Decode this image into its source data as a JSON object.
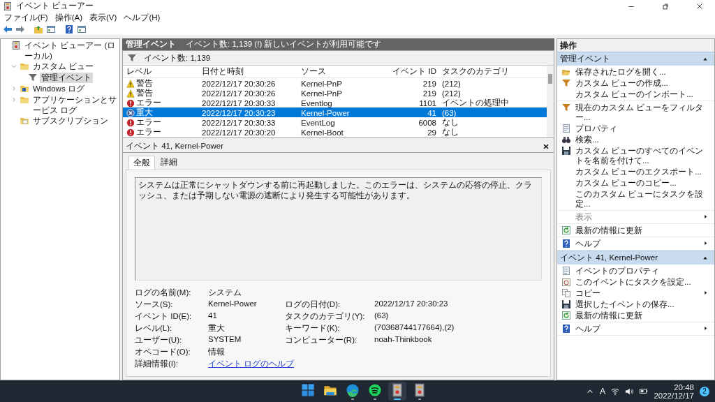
{
  "window": {
    "title": "イベント ビューアー"
  },
  "menu": [
    "ファイル(F)",
    "操作(A)",
    "表示(V)",
    "ヘルプ(H)"
  ],
  "tree": [
    {
      "label": "イベント ビューアー (ローカル)",
      "kind": "viewer",
      "selected": false,
      "children": [
        {
          "label": "カスタム ビュー",
          "kind": "folder",
          "expanded": true,
          "selected": false,
          "children": [
            {
              "label": "管理イベント",
              "kind": "filter",
              "selected": true
            }
          ]
        },
        {
          "label": "Windows ログ",
          "kind": "log",
          "expanded": false,
          "selected": false
        },
        {
          "label": "アプリケーションとサービス ログ",
          "kind": "folder",
          "expanded": false,
          "selected": false
        },
        {
          "label": "サブスクリプション",
          "kind": "subscription",
          "selected": false
        }
      ]
    }
  ],
  "center": {
    "title": "管理イベント",
    "notice": "イベント数: 1,139 (!) 新しいイベントが利用可能です",
    "filter_label": "イベント数: 1,139"
  },
  "table": {
    "columns": [
      "レベル",
      "日付と時刻",
      "ソース",
      "イベント ID",
      "タスクのカテゴリ"
    ],
    "rows": [
      {
        "kind": "warning",
        "level": "警告",
        "date": "2022/12/17 20:30:26",
        "source": "Kernel-PnP",
        "event_id": "219",
        "category": "(212)",
        "selected": false
      },
      {
        "kind": "warning",
        "level": "警告",
        "date": "2022/12/17 20:30:26",
        "source": "Kernel-PnP",
        "event_id": "219",
        "category": "(212)",
        "selected": false
      },
      {
        "kind": "error",
        "level": "エラー",
        "date": "2022/12/17 20:30:33",
        "source": "Eventlog",
        "event_id": "1101",
        "category": "イベントの処理中",
        "selected": false
      },
      {
        "kind": "critical",
        "level": "重大",
        "date": "2022/12/17 20:30:23",
        "source": "Kernel-Power",
        "event_id": "41",
        "category": "(63)",
        "selected": true
      },
      {
        "kind": "error",
        "level": "エラー",
        "date": "2022/12/17 20:30:33",
        "source": "EventLog",
        "event_id": "6008",
        "category": "なし",
        "selected": false
      },
      {
        "kind": "error",
        "level": "エラー",
        "date": "2022/12/17 20:30:20",
        "source": "Kernel-Boot",
        "event_id": "29",
        "category": "なし",
        "selected": false
      }
    ]
  },
  "detail": {
    "title": "イベント 41, Kernel-Power",
    "tabs": [
      {
        "label": "全般",
        "selected": true
      },
      {
        "label": "詳細",
        "selected": false
      }
    ],
    "description": "システムは正常にシャットダウンする前に再起動しました。このエラーは、システムの応答の停止、クラッシュ、または予期しない電源の遮断により発生する可能性があります。",
    "rows": [
      {
        "left": {
          "label": "ログの名前(M):",
          "value": "システム"
        }
      },
      {
        "left": {
          "label": "ソース(S):",
          "value": "Kernel-Power"
        },
        "right": {
          "label": "ログの日付(D):",
          "value": "2022/12/17 20:30:23"
        }
      },
      {
        "left": {
          "label": "イベント ID(E):",
          "value": "41"
        },
        "right": {
          "label": "タスクのカテゴリ(Y):",
          "value": "(63)"
        }
      },
      {
        "left": {
          "label": "レベル(L):",
          "value": "重大"
        },
        "right": {
          "label": "キーワード(K):",
          "value": "(70368744177664),(2)"
        }
      },
      {
        "left": {
          "label": "ユーザー(U):",
          "value": "SYSTEM"
        },
        "right": {
          "label": "コンピューター(R):",
          "value": "noah-Thinkbook"
        }
      },
      {
        "left": {
          "label": "オペコード(O):",
          "value": "情報"
        }
      },
      {
        "left": {
          "label": "詳細情報(I):",
          "value": "イベント ログのヘルプ",
          "kind": "link"
        }
      }
    ]
  },
  "actions": {
    "title": "操作",
    "sections": [
      {
        "title": "管理イベント",
        "expanded": true,
        "groups": [
          [
            {
              "label": "保存されたログを開く...",
              "kind": "open",
              "submenu": false,
              "disabled": false
            },
            {
              "label": "カスタム ビューの作成...",
              "kind": "filter",
              "submenu": false,
              "disabled": false
            },
            {
              "label": "カスタム ビューのインポート...",
              "kind": "plain",
              "submenu": false,
              "disabled": false
            }
          ],
          [
            {
              "label": "現在のカスタム ビューをフィルター...",
              "kind": "filter",
              "submenu": false,
              "disabled": false
            },
            {
              "label": "プロパティ",
              "kind": "properties",
              "submenu": false,
              "disabled": false
            },
            {
              "label": "検索...",
              "kind": "find",
              "submenu": false,
              "disabled": false
            },
            {
              "label": "カスタム ビューのすべてのイベントを名前を付けて...",
              "kind": "save",
              "submenu": false,
              "disabled": false
            },
            {
              "label": "カスタム ビューのエクスポート...",
              "kind": "plain",
              "submenu": false,
              "disabled": false
            },
            {
              "label": "カスタム ビューのコピー...",
              "kind": "plain",
              "submenu": false,
              "disabled": false
            },
            {
              "label": "このカスタム ビューにタスクを設定...",
              "kind": "plain",
              "submenu": false,
              "disabled": false
            }
          ],
          [
            {
              "label": "表示",
              "kind": "plain",
              "submenu": true,
              "disabled": true
            }
          ],
          [
            {
              "label": "最新の情報に更新",
              "kind": "refresh",
              "submenu": false,
              "disabled": false
            }
          ],
          [
            {
              "label": "ヘルプ",
              "kind": "help",
              "submenu": true,
              "disabled": false
            }
          ]
        ]
      },
      {
        "title": "イベント 41, Kernel-Power",
        "expanded": true,
        "groups": [
          [
            {
              "label": "イベントのプロパティ",
              "kind": "properties",
              "submenu": false,
              "disabled": false
            },
            {
              "label": "このイベントにタスクを設定...",
              "kind": "task",
              "submenu": false,
              "disabled": false
            },
            {
              "label": "コピー",
              "kind": "copy",
              "submenu": true,
              "disabled": false
            },
            {
              "label": "選択したイベントの保存...",
              "kind": "save",
              "submenu": false,
              "disabled": false
            },
            {
              "label": "最新の情報に更新",
              "kind": "refresh",
              "submenu": false,
              "disabled": false
            }
          ],
          [
            {
              "label": "ヘルプ",
              "kind": "help",
              "submenu": true,
              "disabled": false
            }
          ]
        ]
      }
    ]
  },
  "taskbar": {
    "apps": [
      {
        "kind": "start",
        "selected": false,
        "running": false
      },
      {
        "kind": "explorer",
        "selected": false,
        "running": false
      },
      {
        "kind": "edge",
        "selected": false,
        "running": true
      },
      {
        "kind": "spotify",
        "selected": false,
        "running": true
      },
      {
        "kind": "viewer",
        "selected": true,
        "running": true
      },
      {
        "kind": "viewer",
        "selected": false,
        "running": true
      }
    ],
    "ime": "A",
    "time": "20:48",
    "date": "2022/12/17",
    "notifications": "2"
  }
}
